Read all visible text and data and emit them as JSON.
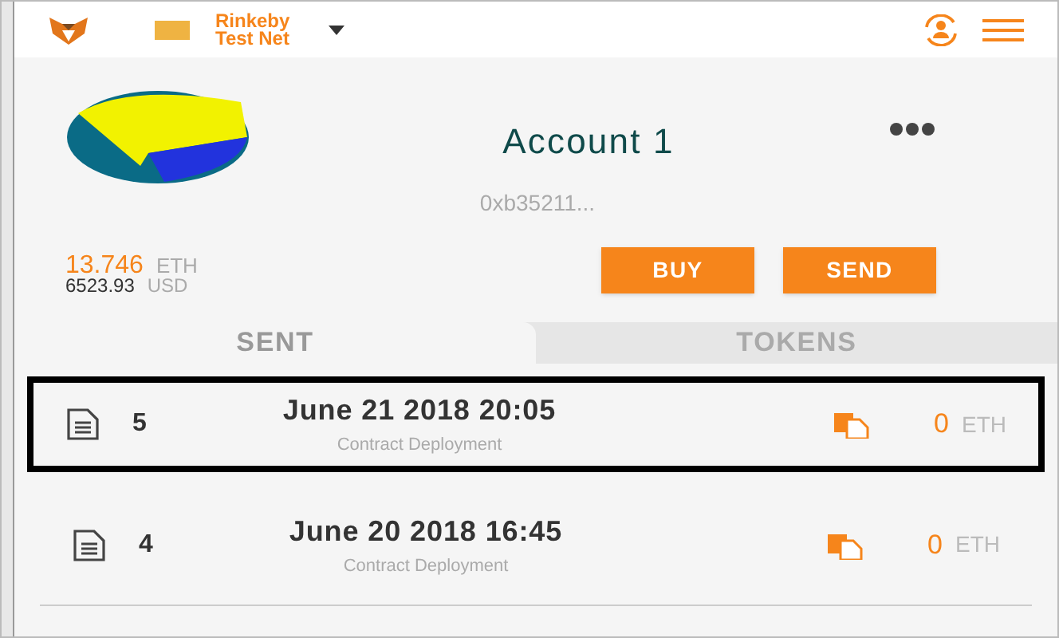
{
  "header": {
    "network": "Rinkeby Test Net"
  },
  "account": {
    "name": "Account 1",
    "address": "0xb35211...",
    "balance": "13.746",
    "balance_unit": "ETH",
    "fiat": "6523.93",
    "fiat_unit": "USD"
  },
  "buttons": [
    "BUY",
    "SEND"
  ],
  "tabs": [
    {
      "label": "SENT",
      "selected": true
    },
    {
      "label": "TOKENS",
      "selected": false
    }
  ],
  "transactions": [
    {
      "nonce": "5",
      "date": "June 21 2018 20:05",
      "action": "Contract Deployment",
      "amount": "0",
      "unit": "ETH",
      "highlighted": true
    },
    {
      "nonce": "4",
      "date": "June 20 2018 16:45",
      "action": "Contract Deployment",
      "amount": "0",
      "unit": "ETH",
      "highlighted": false
    }
  ]
}
